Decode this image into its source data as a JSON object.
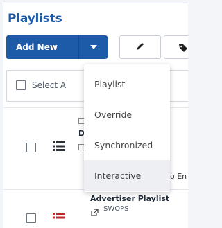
{
  "page": {
    "title": "Playlists"
  },
  "toolbar": {
    "add_new_label": "Add New"
  },
  "bulk": {
    "select_all_label": "Select A"
  },
  "dropdown": {
    "items": [
      {
        "label": "Playlist"
      },
      {
        "label": "Override"
      },
      {
        "label": "Synchronized"
      },
      {
        "label": "Interactive"
      }
    ]
  },
  "rows": [
    {
      "title_fragment": "D",
      "desc_fragment": "o En"
    },
    {
      "title": "Advertiser Playlist",
      "owner": "SWOPS"
    }
  ],
  "colors": {
    "brand_blue": "#1d5aa8",
    "list_icon_dark": "#2b2f36",
    "list_icon_red": "#c2262e"
  }
}
